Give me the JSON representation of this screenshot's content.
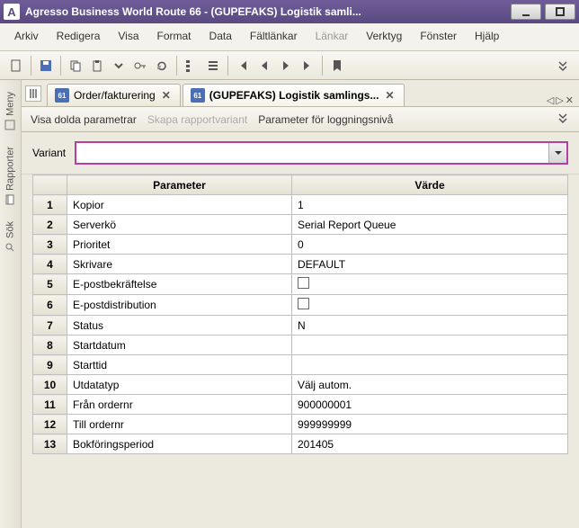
{
  "window": {
    "title": "Agresso Business World Route 66 - (GUPEFAKS) Logistik samli..."
  },
  "menu": {
    "items": [
      "Arkiv",
      "Redigera",
      "Visa",
      "Format",
      "Data",
      "Fältlänkar",
      "Länkar",
      "Verktyg",
      "Fönster",
      "Hjälp"
    ],
    "disabled_index": 6
  },
  "doc_tabs": {
    "tab1": {
      "label": "Order/fakturering",
      "icon": "61"
    },
    "tab2": {
      "label": "(GUPEFAKS) Logistik samlings...",
      "icon": "61"
    }
  },
  "subtoolbar": {
    "show_hidden": "Visa dolda parametrar",
    "create_variant": "Skapa rapportvariant",
    "log_level": "Parameter för loggningsnivå"
  },
  "variant": {
    "label": "Variant",
    "value": ""
  },
  "table": {
    "headers": {
      "param": "Parameter",
      "value": "Värde"
    },
    "rows": [
      {
        "n": "1",
        "param": "Kopior",
        "value": "1"
      },
      {
        "n": "2",
        "param": "Serverkö",
        "value": "Serial Report Queue"
      },
      {
        "n": "3",
        "param": "Prioritet",
        "value": "0"
      },
      {
        "n": "4",
        "param": "Skrivare",
        "value": "DEFAULT"
      },
      {
        "n": "5",
        "param": "E-postbekräftelse",
        "value": "",
        "checkbox": true
      },
      {
        "n": "6",
        "param": "E-postdistribution",
        "value": "",
        "checkbox": true
      },
      {
        "n": "7",
        "param": "Status",
        "value": "N"
      },
      {
        "n": "8",
        "param": "Startdatum",
        "value": ""
      },
      {
        "n": "9",
        "param": "Starttid",
        "value": ""
      },
      {
        "n": "10",
        "param": "Utdatatyp",
        "value": "Välj autom."
      },
      {
        "n": "11",
        "param": "Från ordernr",
        "value": "900000001"
      },
      {
        "n": "12",
        "param": "Till ordernr",
        "value": "999999999"
      },
      {
        "n": "13",
        "param": "Bokföringsperiod",
        "value": "201405"
      }
    ]
  },
  "left_rail": {
    "meny": "Meny",
    "rapporter": "Rapporter",
    "sok": "Sök"
  }
}
